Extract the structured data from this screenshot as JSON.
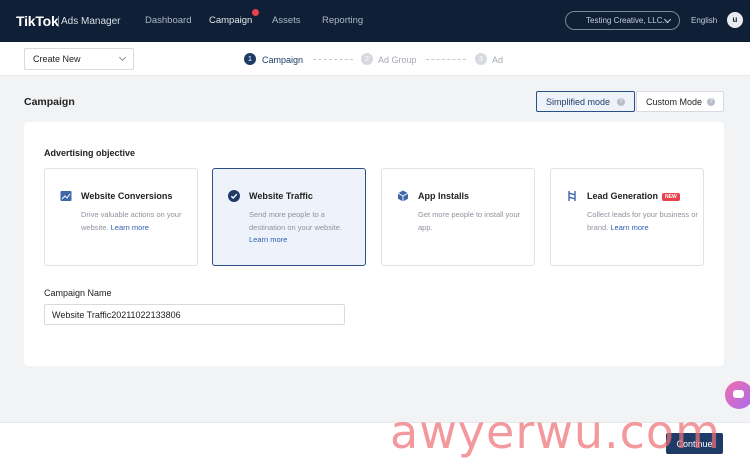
{
  "nav": {
    "logo": "TikTok",
    "logo_sub": "Ads Manager",
    "items": [
      "Dashboard",
      "Campaign",
      "Assets",
      "Reporting"
    ],
    "account": "Testing Creative, LLC...",
    "language": "English",
    "avatar_initial": "u"
  },
  "stepbar": {
    "create_select": "Create New",
    "steps": [
      {
        "num": "1",
        "label": "Campaign"
      },
      {
        "num": "2",
        "label": "Ad Group"
      },
      {
        "num": "3",
        "label": "Ad"
      }
    ]
  },
  "page": {
    "title": "Campaign",
    "simplified_mode": "Simplified mode",
    "custom_mode": "Custom Mode"
  },
  "objective": {
    "label": "Advertising objective",
    "options": [
      {
        "title": "Website Conversions",
        "desc": "Drive valuable actions on your website.",
        "link": "Learn more",
        "icon": "image-icon"
      },
      {
        "title": "Website Traffic",
        "desc": "Send more people to a destination on your website.",
        "link": "Learn more",
        "icon": "check-circle-icon"
      },
      {
        "title": "App Installs",
        "desc": "Get more people to install your app.",
        "link": "",
        "icon": "cube-icon"
      },
      {
        "title": "Lead Generation",
        "desc": "Collect leads for your business or brand.",
        "link": "Learn more",
        "icon": "lead-icon",
        "badge": "NEW"
      }
    ]
  },
  "campaign_name": {
    "label": "Campaign Name",
    "value": "Website Traffic20211022133806"
  },
  "footer": {
    "continue": "Continue"
  },
  "watermark": "awyerwu.com",
  "colors": {
    "nav_bg": "#0f1f35",
    "accent": "#1e3b67",
    "link": "#2a5fb0",
    "badge": "#e9424e"
  }
}
